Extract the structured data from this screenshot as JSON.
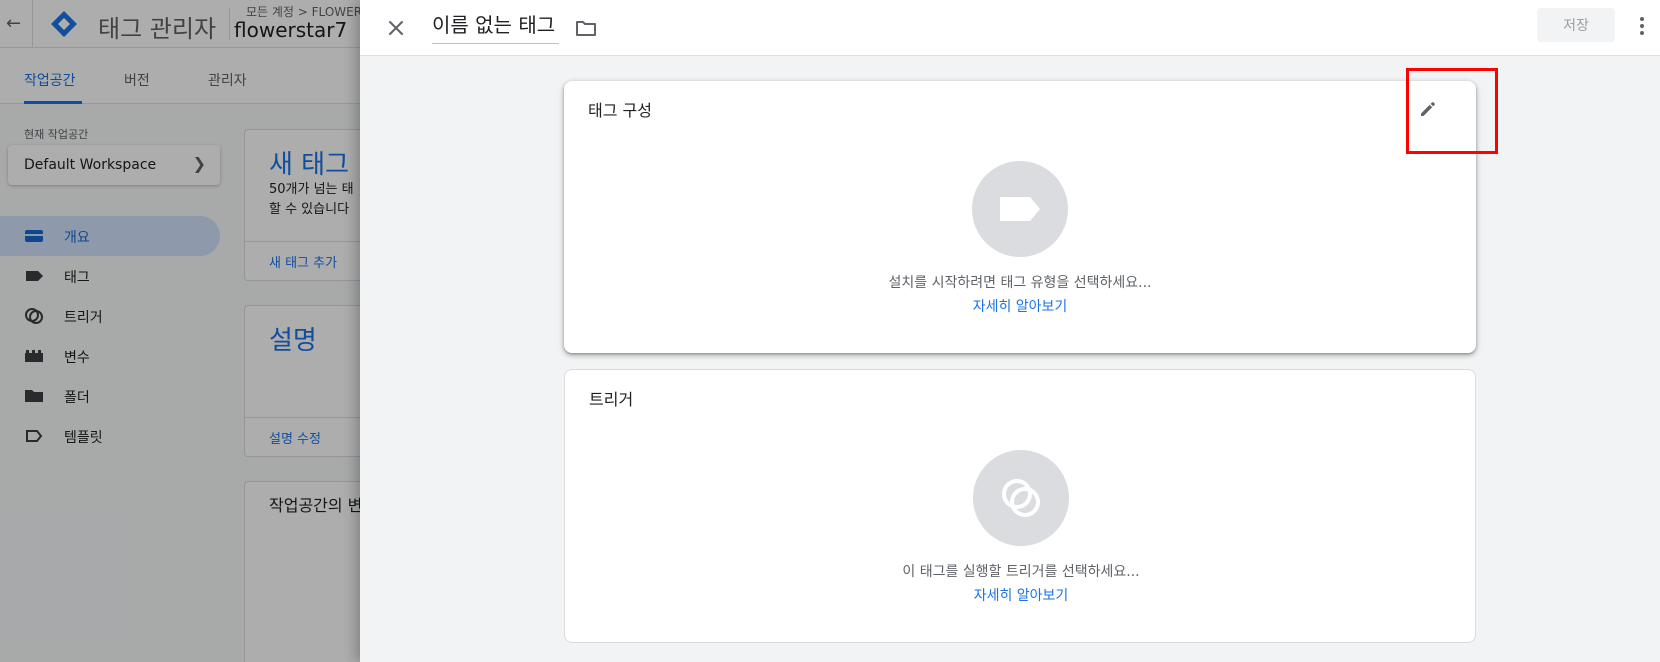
{
  "background": {
    "app_title": "태그 관리자",
    "breadcrumb": "모든 계정 > FLOWER",
    "account_name": "flowerstar7",
    "tabs": [
      {
        "label": "작업공간"
      },
      {
        "label": "버전"
      },
      {
        "label": "관리자"
      }
    ],
    "workspace_label": "현재 작업공간",
    "workspace_name": "Default Workspace",
    "nav_items": [
      {
        "label": "개요",
        "icon": "overview-icon"
      },
      {
        "label": "태그",
        "icon": "tag-icon"
      },
      {
        "label": "트리거",
        "icon": "trigger-icon"
      },
      {
        "label": "변수",
        "icon": "variable-icon"
      },
      {
        "label": "폴더",
        "icon": "folder-icon"
      },
      {
        "label": "템플릿",
        "icon": "template-icon"
      }
    ],
    "cards": {
      "new_tag_title": "새 태그",
      "new_tag_text_1": "50개가 넘는 태",
      "new_tag_text_2": "할 수 있습니다",
      "new_tag_link": "새 태그 추가",
      "description_title": "설명",
      "description_link": "설명 수정",
      "workspace_changes": "작업공간의 변"
    }
  },
  "panel": {
    "tag_name": "이름 없는 태그",
    "save_label": "저장",
    "config_card": {
      "title": "태그 구성",
      "hint": "설치를 시작하려면 태그 유형을 선택하세요...",
      "link": "자세히 알아보기"
    },
    "trigger_card": {
      "title": "트리거",
      "hint": "이 태그를 실행할 트리거를 선택하세요...",
      "link": "자세히 알아보기"
    }
  },
  "colors": {
    "accent": "#1a73e8",
    "highlight": "#ff0000",
    "placeholder": "#dadce0"
  }
}
